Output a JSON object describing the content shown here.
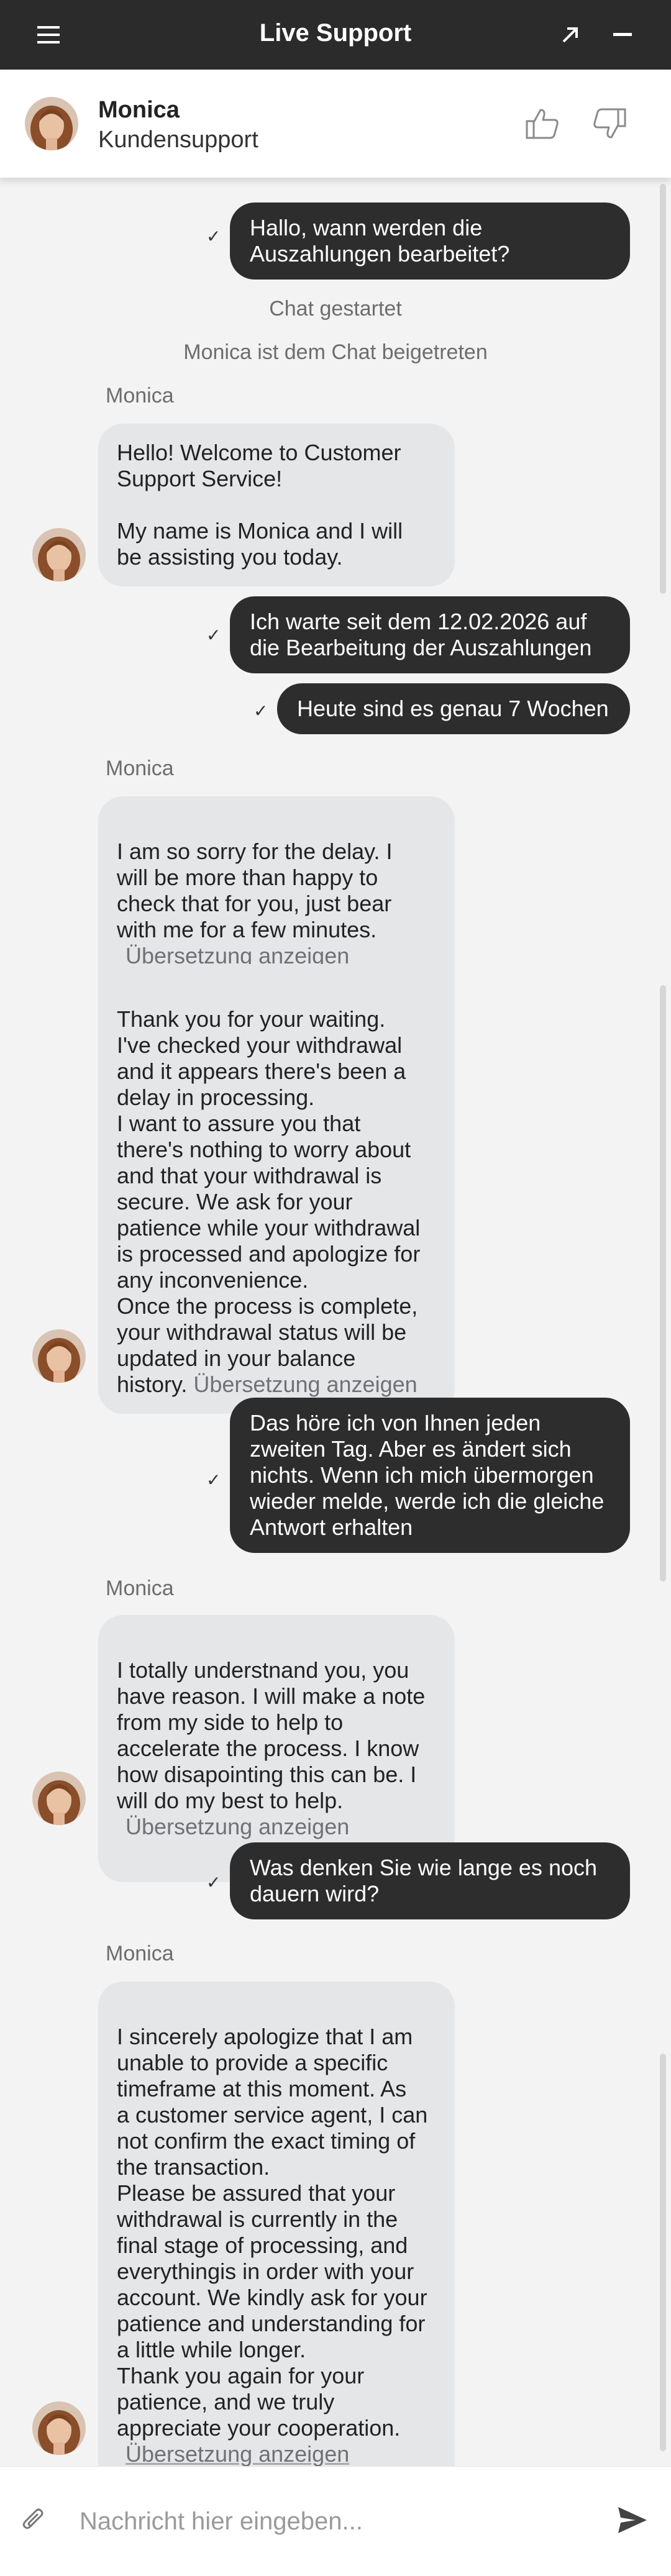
{
  "header": {
    "title": "Live Support",
    "menu_icon": "menu-icon",
    "expand_icon": "expand-arrow-icon",
    "minimize_icon": "minimize-icon",
    "background": "#2b2b2b"
  },
  "agent": {
    "name": "Monica",
    "role": "Kundensupport",
    "thumbs_up_icon": "thumbs-up-icon",
    "thumbs_down_icon": "thumbs-down-icon"
  },
  "messages": {
    "m1": "Hallo, wann werden die\nAuszahlungen bearbeitet?",
    "sys1": "Chat gestartet",
    "sys2": "Monica ist dem Chat beigetreten",
    "sender1": "Monica",
    "a1": "Hello! Welcome to Customer\nSupport Service!\n\nMy name is Monica and I will\nbe assisting you today.",
    "m2": "Ich warte seit dem 12.02.2026 auf\ndie Bearbeitung der Auszahlungen",
    "m3": "Heute sind es genau 7 Wochen",
    "sender2": "Monica",
    "a2": "I am so sorry for the delay. I\nwill be more than happy to\ncheck that for you, just bear\nwith me for a few minutes.",
    "a2_translate": "Übersetzung anzeigen",
    "a3": "Thank you for your waiting.\nI've checked your withdrawal\nand it appears there's been a\ndelay in processing.\nI want to assure you that\nthere's nothing to worry about\nand that your withdrawal is\nsecure. We ask for your\npatience while your withdrawal\nis processed and apologize for\nany inconvenience.\nOnce the process is complete,\nyour withdrawal status will be\nupdated in your balance\nhistory.",
    "a3_translate": "Übersetzung anzeigen",
    "m4": "Das höre ich von Ihnen jeden\nzweiten Tag. Aber es ändert sich\nnichts. Wenn ich mich übermorgen\nwieder melde, werde ich die gleiche\nAntwort erhalten",
    "sender3": "Monica",
    "a4": "I totally understnand you, you\nhave reason. I will make a note\nfrom my side to help to\naccelerate the process. I know\nhow disapointing this can be. I\nwill do my best to help.",
    "a4_translate": "Übersetzung anzeigen",
    "m5": "Was denken Sie wie lange es noch\ndauern wird?",
    "sender4": "Monica",
    "a5": "I sincerely apologize that I am\nunable to provide a specific\ntimeframe at this moment. As\na customer service agent, I can\nnot confirm the exact timing of\nthe transaction.\nPlease be assured that your\nwithdrawal is currently in the\nfinal stage of processing, and\neverythingis in order with your\naccount. We kindly ask for your\npatience and understanding for\na little while longer.\nThank you again for your\npatience, and we truly\nappreciate your cooperation.",
    "a5_translate": "Übersetzung anzeigen",
    "check_glyph": "✓"
  },
  "composer": {
    "placeholder": "Nachricht hier eingeben...",
    "attach_icon": "paperclip-icon",
    "send_icon": "send-icon"
  }
}
